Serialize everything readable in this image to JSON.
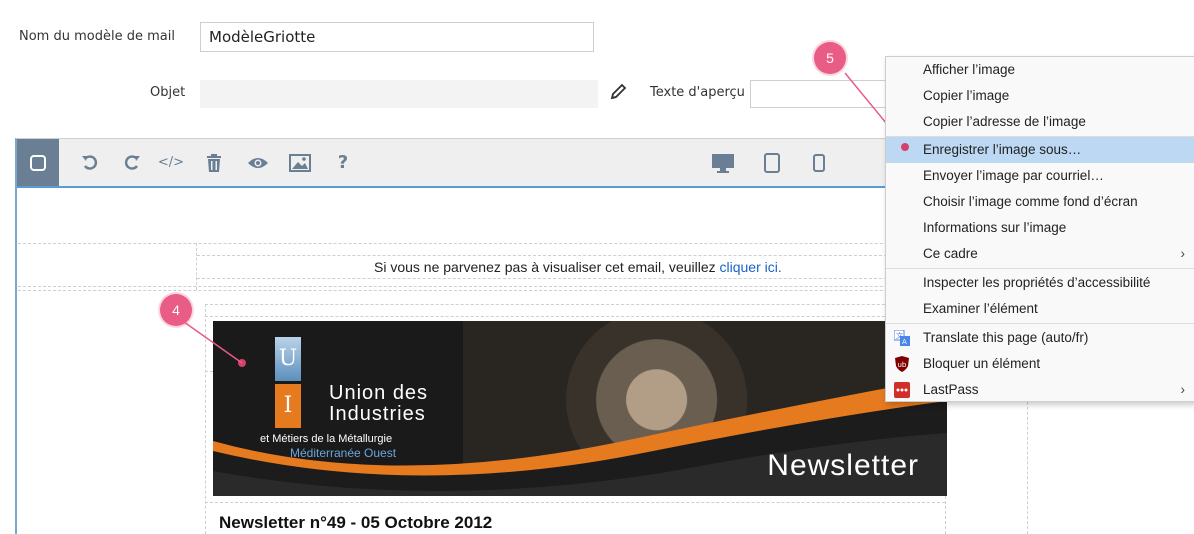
{
  "form": {
    "template_name_label": "Nom du modèle de mail",
    "template_name_value": "ModèleGriotte",
    "subject_label": "Objet",
    "subject_value": "",
    "preview_label": "Texte d'aperçu",
    "preview_value": ""
  },
  "toolbar": {
    "buttons": [
      "select-icon",
      "undo-icon",
      "redo-icon",
      "code-icon",
      "trash-icon",
      "eye-icon",
      "image-icon",
      "help-icon"
    ],
    "device_buttons": [
      "desktop-icon",
      "tablet-icon",
      "mobile-icon"
    ],
    "help_glyph": "?",
    "code_glyph": "</>"
  },
  "email": {
    "view_online_text": "Si vous ne parvenez pas à visualiser cet email, veuillez ",
    "view_online_link": "cliquer ici.",
    "banner": {
      "logo_letter_top": "U",
      "logo_letter_bottom": "I",
      "org_line1": "Union des",
      "org_line2": "Industries",
      "org_sub": "et Métiers de la Métallurgie",
      "org_region": "Méditerranée Ouest",
      "banner_word": "Newsletter"
    },
    "issue_title": "Newsletter n°49 - 05 Octobre 2012"
  },
  "markers": {
    "m4": "4",
    "m5": "5"
  },
  "context_menu": {
    "items": [
      {
        "label": "Afficher l’image"
      },
      {
        "label": "Copier l’image"
      },
      {
        "label": "Copier l’adresse de l’image"
      },
      {
        "label": "Enregistrer l’image sous…"
      },
      {
        "label": "Envoyer l’image par courriel…"
      },
      {
        "label": "Choisir l’image comme fond d’écran"
      },
      {
        "label": "Informations sur l’image"
      },
      {
        "label": "Ce cadre"
      },
      {
        "label": "Inspecter les propriétés d’accessibilité"
      },
      {
        "label": "Examiner l’élément"
      },
      {
        "label": "Translate this page (auto/fr)"
      },
      {
        "label": "Bloquer un élément"
      },
      {
        "label": "LastPass"
      }
    ],
    "submenu_arrow": "›"
  },
  "colors": {
    "marker": "#e85c85",
    "highlight": "#bcd8f2",
    "toolbar_active": "#6a7e94",
    "link": "#1a63c8",
    "brand_orange": "#e67a1f",
    "brand_blue": "#6aa6dc"
  }
}
